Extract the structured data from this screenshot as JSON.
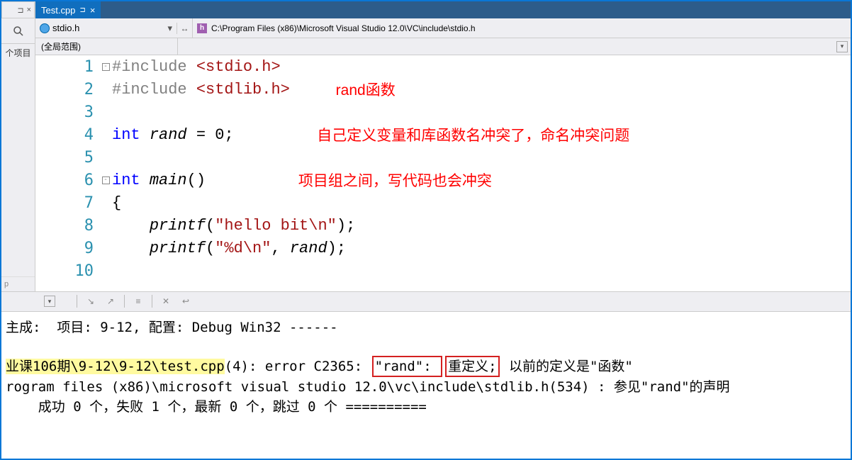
{
  "left_panel": {
    "label": "个项目",
    "p": "p"
  },
  "tab": {
    "name": "Test.cpp",
    "pin": "⊐",
    "close": "×"
  },
  "nav": {
    "file": "stdio.h",
    "path": "C:\\Program Files (x86)\\Microsoft Visual Studio 12.0\\VC\\include\\stdio.h",
    "h": "h"
  },
  "scope": {
    "label": "(全局范围)"
  },
  "lines": [
    "1",
    "2",
    "3",
    "4",
    "5",
    "6",
    "7",
    "8",
    "9",
    "10"
  ],
  "code": {
    "l1": {
      "pre": "#include ",
      "inc": "<stdio.h>"
    },
    "l2": {
      "pre": "#include ",
      "inc": "<stdlib.h>",
      "annot": "rand函数"
    },
    "l4": {
      "kw": "int ",
      "id": "rand",
      "eq": " = ",
      "num": "0",
      "end": ";",
      "annot": "自己定义变量和库函数名冲突了，命名冲突问题"
    },
    "l6": {
      "kw": "int ",
      "id": "main",
      "par": "()",
      "annot": "项目组之间，写代码也会冲突"
    },
    "l7": {
      "brace": "{"
    },
    "l8": {
      "printf": "printf",
      "open": "(",
      "str": "\"hello bit\\n\"",
      "close": ");"
    },
    "l9": {
      "printf": "printf",
      "open": "(",
      "str": "\"%d\\n\"",
      "comma": ", ",
      "id": "rand",
      "close": ");"
    }
  },
  "output": {
    "l1": "主成:  项目: 9-12, 配置: Debug Win32 ------",
    "l2a": "业课106期\\9-12\\9-12\\test.cpp",
    "l2b": "(4): error C2365: ",
    "l2c": "\"rand\": ",
    "l2d": "重定义;",
    "l2e": " 以前的定义是\"函数\"",
    "l3": "rogram files (x86)\\microsoft visual studio 12.0\\vc\\include\\stdlib.h(534) : 参见\"rand\"的声明",
    "l4": "    成功 0 个，失败 1 个，最新 0 个，跳过 0 个 =========="
  }
}
